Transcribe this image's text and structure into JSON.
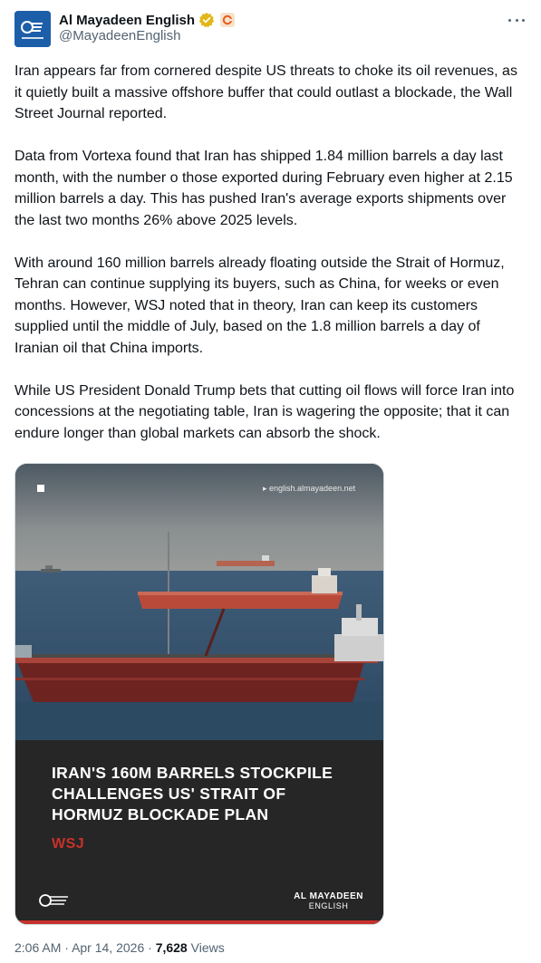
{
  "author": {
    "display_name": "Al Mayadeen English",
    "handle": "@MayadeenEnglish",
    "avatar_icon": "al-mayadeen-logo",
    "verified_icon": "gold-verified-badge",
    "affiliate_icon": "affiliate-badge"
  },
  "more_icon": "more-horizontal-icon",
  "tweet_paragraphs": [
    "Iran appears far from cornered despite US threats to choke its oil revenues, as it quietly built a massive offshore buffer that could outlast a blockade, the Wall Street Journal reported.",
    "Data from Vortexa found that Iran has shipped 1.84 million barrels a day last month, with the number o those exported during February even higher at 2.15 million barrels a day. This has pushed Iran's average exports shipments over the last two months 26% above 2025 levels.",
    "With around 160 million barrels already floating outside the Strait of Hormuz, Tehran can continue supplying its buyers, such as China, for weeks or even months. However, WSJ noted that in theory, Iran can keep its customers supplied until the middle of July, based on the 1.8 million barrels a day of Iranian oil that China imports.",
    "While US President Donald Trump bets that cutting oil flows will force Iran into concessions at the negotiating table, Iran is wagering the opposite; that it can endure longer than global markets can absorb the shock."
  ],
  "media": {
    "watermark": "▸ english.almayadeen.net",
    "headline": "IRAN'S 160M BARRELS STOCKPILE CHALLENGES US' STRAIT OF HORMUZ BLOCKADE PLAN",
    "source": "WSJ",
    "brand_line1": "AL MAYADEEN",
    "brand_line2": "ENGLISH",
    "accent_color": "#c8312b"
  },
  "meta": {
    "time": "2:06 AM",
    "separator": "·",
    "date": "Apr 14, 2026",
    "views_count": "7,628",
    "views_label": "Views"
  }
}
